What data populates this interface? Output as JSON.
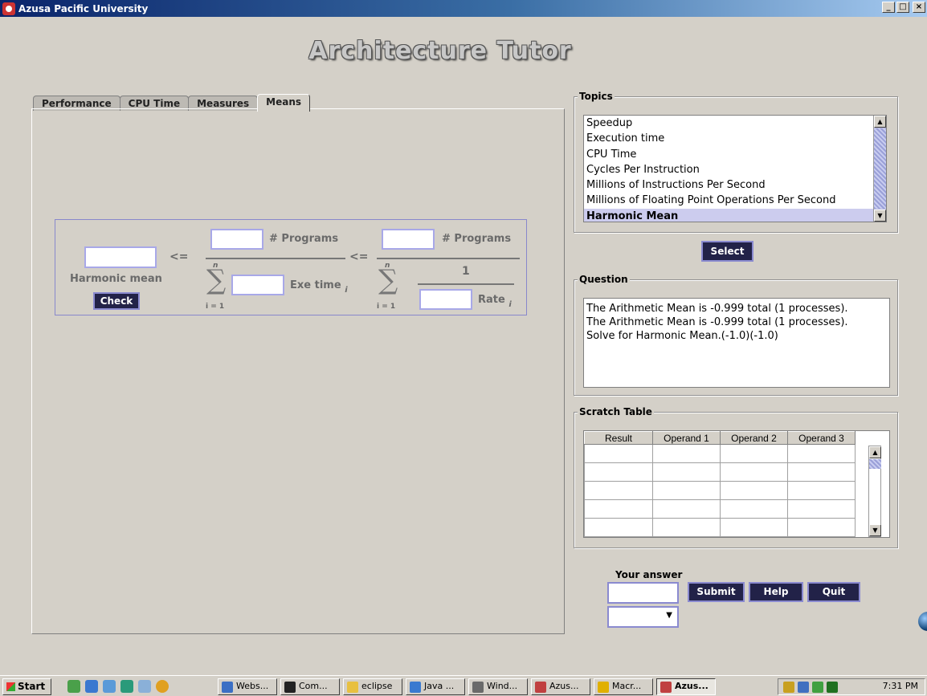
{
  "window": {
    "title": "Azusa Pacific University",
    "buttons": [
      "_",
      "□",
      "×"
    ]
  },
  "app_title": "Architecture Tutor",
  "tabs": [
    {
      "label": "Performance"
    },
    {
      "label": "CPU Time"
    },
    {
      "label": "Measures"
    },
    {
      "label": "Means"
    }
  ],
  "formula": {
    "le1": "<=",
    "le2": "<=",
    "programs1": "# Programs",
    "programs2": "# Programs",
    "harmonic_label": "Harmonic mean",
    "check": "Check",
    "sigma": "∑",
    "n": "n",
    "i_eq_1": "i = 1",
    "exe_time": "Exe time",
    "sub_i": "i",
    "one": "1",
    "rate": "Rate"
  },
  "topics": {
    "label": "Topics",
    "items": [
      "Speedup",
      "Execution time",
      "CPU Time",
      "Cycles Per Instruction",
      "Millions of Instructions Per Second",
      "Millions of Floating Point Operations Per Second",
      "Harmonic Mean"
    ],
    "selected": "Harmonic Mean",
    "select_button": "Select"
  },
  "question": {
    "label": "Question",
    "lines": [
      "The Arithmetic Mean is -0.999 total (1 processes).",
      "The Arithmetic Mean is -0.999 total (1 processes).",
      "Solve for Harmonic Mean.(-1.0)(-1.0)"
    ]
  },
  "scratch": {
    "label": "Scratch Table",
    "columns": [
      "Result",
      "Operand 1",
      "Operand 2",
      "Operand 3"
    ]
  },
  "answer": {
    "label": "Your answer",
    "value": "",
    "submit": "Submit",
    "help": "Help",
    "quit": "Quit"
  },
  "taskbar": {
    "start": "Start",
    "items": [
      {
        "label": "Webs...",
        "color": "#3b6fc4"
      },
      {
        "label": "Com...",
        "color": "#222222"
      },
      {
        "label": "eclipse",
        "color": "#e8c040"
      },
      {
        "label": "Java ...",
        "color": "#3a7ad0"
      },
      {
        "label": "Wind...",
        "color": "#6a6a6a"
      },
      {
        "label": "Azus...",
        "color": "#c04040"
      },
      {
        "label": "Macr...",
        "color": "#e0b000"
      },
      {
        "label": "Azus...",
        "color": "#c04040"
      }
    ],
    "clock": "7:31 PM"
  }
}
